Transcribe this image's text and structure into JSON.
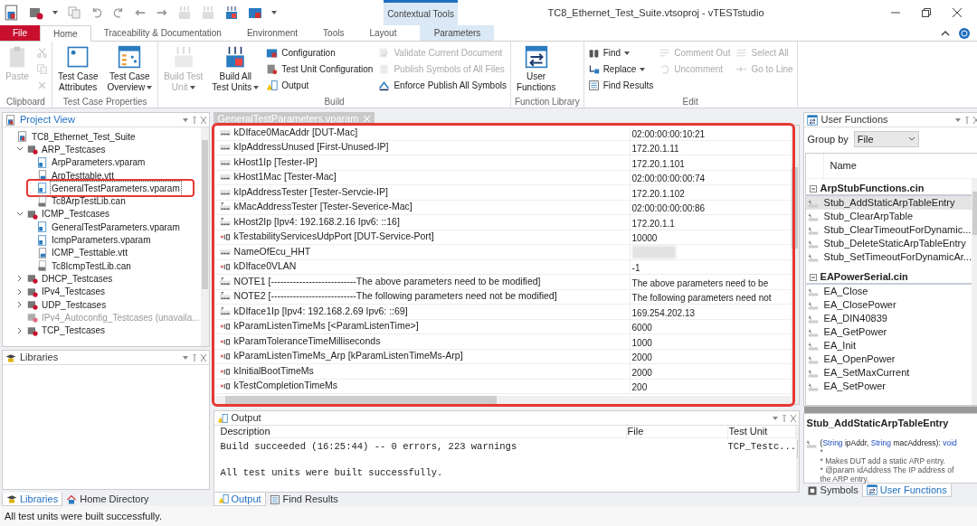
{
  "window": {
    "title": "TC8_Ethernet_Test_Suite.vtsoproj - vTESTstudio",
    "contextual_header": "Contextual Tools"
  },
  "ribbon_tabs": [
    {
      "label": "File",
      "kind": "file",
      "selected": false
    },
    {
      "label": "Home",
      "kind": "normal",
      "selected": true
    },
    {
      "label": "Traceability & Documentation",
      "kind": "normal",
      "selected": false
    },
    {
      "label": "Environment",
      "kind": "normal",
      "selected": false
    },
    {
      "label": "Tools",
      "kind": "normal",
      "selected": false
    },
    {
      "label": "Layout",
      "kind": "normal",
      "selected": false
    },
    {
      "label": "Parameters",
      "kind": "contextual",
      "selected": false
    }
  ],
  "ribbon_groups": [
    {
      "label": "Clipboard",
      "controls": [
        {
          "kind": "large",
          "lines": [
            "Paste"
          ],
          "disabled": true,
          "dropdown": false
        },
        {
          "kind": "column",
          "items": [
            {
              "disabled": true
            },
            {
              "disabled": true
            },
            {
              "disabled": true
            }
          ]
        }
      ]
    },
    {
      "label": "Test Case Properties",
      "controls": [
        {
          "kind": "large",
          "lines": [
            "Test Case",
            "Attributes"
          ],
          "disabled": false,
          "dropdown": false
        },
        {
          "kind": "large",
          "lines": [
            "Test Case",
            "Overview"
          ],
          "disabled": false,
          "dropdown": true
        }
      ]
    },
    {
      "label": "Build",
      "controls": [
        {
          "kind": "large",
          "lines": [
            "Build Test",
            "Unit"
          ],
          "disabled": true,
          "dropdown": true
        },
        {
          "kind": "large",
          "lines": [
            "Build All",
            "Test Units"
          ],
          "disabled": false,
          "dropdown": true
        },
        {
          "kind": "column",
          "items": [
            {
              "label": "Configuration",
              "disabled": false
            },
            {
              "label": "Test Unit Configuration",
              "disabled": false
            },
            {
              "label": "Output",
              "disabled": false
            }
          ]
        },
        {
          "kind": "column",
          "items": [
            {
              "label": "Validate Current Document",
              "disabled": true
            },
            {
              "label": "Publish Symbols of All Files",
              "disabled": true
            },
            {
              "label": "Enforce Publish All Symbols",
              "disabled": false
            }
          ]
        }
      ]
    },
    {
      "label": "Function Library",
      "controls": [
        {
          "kind": "large",
          "lines": [
            "User",
            "Functions"
          ],
          "disabled": false,
          "dropdown": false
        }
      ]
    },
    {
      "label": "Edit",
      "controls": [
        {
          "kind": "column",
          "items": [
            {
              "label": "Find",
              "disabled": false,
              "dropdown": true
            },
            {
              "label": "Replace",
              "disabled": false,
              "dropdown": true
            },
            {
              "label": "Find Results",
              "disabled": false
            }
          ]
        },
        {
          "kind": "column",
          "items": [
            {
              "label": "Comment Out",
              "disabled": true
            },
            {
              "label": "Uncomment",
              "disabled": true
            }
          ]
        },
        {
          "kind": "column",
          "items": [
            {
              "label": "Select All",
              "disabled": true
            },
            {
              "label": "Go to Line",
              "disabled": true
            }
          ]
        }
      ]
    }
  ],
  "project_view": {
    "title": "Project View",
    "tree": [
      {
        "label": "TC8_Ethernet_Test_Suite",
        "kind": "project",
        "selected": false,
        "children": [
          {
            "label": "ARP_Testcases",
            "kind": "folder",
            "selected": false,
            "expanded": true,
            "unavailable": false,
            "children": [
              {
                "label": "ArpParameters.vparam",
                "kind": "vparam",
                "selected": false
              },
              {
                "label": "ArpTesttable.vtt",
                "kind": "vtt",
                "selected": false
              },
              {
                "label": "GeneralTestParameters.vparam",
                "kind": "vparam",
                "selected": true,
                "highlighted": true
              },
              {
                "label": "Tc8ArpTestLib.can",
                "kind": "can",
                "selected": false
              }
            ]
          },
          {
            "label": "ICMP_Testcases",
            "kind": "folder",
            "selected": false,
            "expanded": true,
            "unavailable": false,
            "children": [
              {
                "label": "GeneralTestParameters.vparam",
                "kind": "vparam",
                "selected": false
              },
              {
                "label": "IcmpParameters.vparam",
                "kind": "vparam",
                "selected": false
              },
              {
                "label": "ICMP_Testtable.vtt",
                "kind": "vtt",
                "selected": false
              },
              {
                "label": "Tc8IcmpTestLib.can",
                "kind": "can",
                "selected": false
              }
            ]
          },
          {
            "label": "DHCP_Testcases",
            "kind": "folder",
            "selected": false,
            "expanded": false,
            "unavailable": false
          },
          {
            "label": "IPv4_Testcases",
            "kind": "folder",
            "selected": false,
            "expanded": false,
            "unavailable": false
          },
          {
            "label": "UDP_Testcases",
            "kind": "folder",
            "selected": false,
            "expanded": false,
            "unavailable": false
          },
          {
            "label": "IPv4_Autoconfig_Testcases (unavaila...",
            "kind": "folder",
            "selected": false,
            "unavailable": true
          },
          {
            "label": "TCP_Testcases",
            "kind": "folder",
            "selected": false,
            "expanded": false,
            "unavailable": false
          }
        ]
      }
    ]
  },
  "libraries": {
    "title": "Libraries"
  },
  "left_tabs": [
    {
      "label": "Libraries",
      "selected": true
    },
    {
      "label": "Home Directory",
      "selected": false
    }
  ],
  "document_tab": {
    "label": "GeneralTestParameters.vparam"
  },
  "parameters": [
    {
      "name": "kDIface0MacAddr [DUT-Mac]",
      "kind": "string",
      "value": "02:00:00:00:10:21"
    },
    {
      "name": "kIpAddressUnused [First-Unused-IP]",
      "kind": "string",
      "value": "172.20.1.11"
    },
    {
      "name": "kHost1Ip [Tester-IP]",
      "kind": "string",
      "value": "172.20.1.101"
    },
    {
      "name": "kHost1Mac [Tester-Mac]",
      "kind": "string",
      "value": "02:00:00:00:00:74"
    },
    {
      "name": "kIpAddressTester [Tester-Servcie-IP]",
      "kind": "string",
      "value": "172.20.1.102"
    },
    {
      "name": "kMacAddressTester [Tester-Severice-Mac]",
      "kind": "string_ref",
      "value": "02:00:00:00:00:86"
    },
    {
      "name": "kHost2Ip [Ipv4: 192.168.2.16 Ipv6: ::16]",
      "kind": "string_ref",
      "value": "172.20.1.1"
    },
    {
      "name": "kTestabilityServicesUdpPort [DUT-Service-Port]",
      "kind": "int",
      "value": "10000"
    },
    {
      "name": "NameOfEcu_HHT",
      "kind": "string",
      "redacted": true
    },
    {
      "name": "kDIface0VLAN",
      "kind": "int",
      "value": "-1"
    },
    {
      "name": "NOTE1 [---------------------------The above parameters need to be modified]",
      "kind": "string_ref",
      "value": "The above parameters need to be"
    },
    {
      "name": "NOTE2 [---------------------------The following parameters need not be modified]",
      "kind": "string_ref",
      "value": "The following parameters need not"
    },
    {
      "name": "kDIface1Ip [Ipv4: 192.168.2.69 Ipv6: ::69]",
      "kind": "string_ref",
      "value": "169.254.202.13"
    },
    {
      "name": "kParamListenTimeMs [<ParamListenTime>]",
      "kind": "int",
      "value": "6000"
    },
    {
      "name": "kParamToleranceTimeMilliseconds",
      "kind": "int",
      "value": "1000"
    },
    {
      "name": "kParamListenTimeMs_Arp [kParamListenTimeMs-Arp]",
      "kind": "int",
      "value": "2000"
    },
    {
      "name": "kInitialBootTimeMs",
      "kind": "int",
      "value": "2000"
    },
    {
      "name": "kTestCompletionTimeMs",
      "kind": "int",
      "value": "200"
    }
  ],
  "output": {
    "title": "Output",
    "columns": [
      "Description",
      "File",
      "Test Unit"
    ],
    "rows": [
      {
        "description": "Build succeeded (16:25:44) -- 0 errors, 223 warnings",
        "test_unit": "TCP_Testc..."
      },
      {
        "description": "All test units were built successfully."
      }
    ]
  },
  "center_tabs": [
    {
      "label": "Output",
      "selected": true
    },
    {
      "label": "Find Results",
      "selected": false
    }
  ],
  "user_functions": {
    "title": "User Functions",
    "group_by_label": "Group by",
    "group_by_value": "File",
    "column": "Name",
    "groups": [
      {
        "file": "ArpStubFunctions.cin",
        "expanded": true,
        "items": [
          {
            "name": "Stub_AddStaticArpTableEntry",
            "selected": true
          },
          {
            "name": "Stub_ClearArpTable",
            "selected": false
          },
          {
            "name": "Stub_ClearTimeoutForDynamic...",
            "selected": false
          },
          {
            "name": "Stub_DeleteStaticArpTableEntry",
            "selected": false
          },
          {
            "name": "Stub_SetTimeoutForDynamicAr...",
            "selected": false
          }
        ]
      },
      {
        "file": "EAPowerSerial.cin",
        "expanded": true,
        "items": [
          {
            "name": "EA_Close",
            "selected": false
          },
          {
            "name": "EA_ClosePower",
            "selected": false
          },
          {
            "name": "EA_DIN40839",
            "selected": false
          },
          {
            "name": "EA_GetPower",
            "selected": false
          },
          {
            "name": "EA_Init",
            "selected": false
          },
          {
            "name": "EA_OpenPower",
            "selected": false
          },
          {
            "name": "EA_SetMaxCurrent",
            "selected": false
          },
          {
            "name": "EA_SetPower",
            "selected": false
          }
        ]
      }
    ]
  },
  "function_details": {
    "title": "Stub_AddStaticArpTableEntry",
    "signature": [
      {
        "text": "(",
        "kind": "plain"
      },
      {
        "text": "String",
        "kind": "type"
      },
      {
        "text": " ipAddr, ",
        "kind": "plain"
      },
      {
        "text": "String",
        "kind": "type"
      },
      {
        "text": " macAddress): ",
        "kind": "plain"
      },
      {
        "text": "void",
        "kind": "type"
      }
    ],
    "comment": [
      "*",
      "* Makes DUT add a static ARP entry.",
      "* @param idAddress The IP address of",
      "the ARP entry."
    ]
  },
  "right_tabs": [
    {
      "label": "Symbols",
      "selected": false
    },
    {
      "label": "User Functions",
      "selected": true
    }
  ],
  "status_bar": {
    "text": "All test units were built successfully."
  }
}
